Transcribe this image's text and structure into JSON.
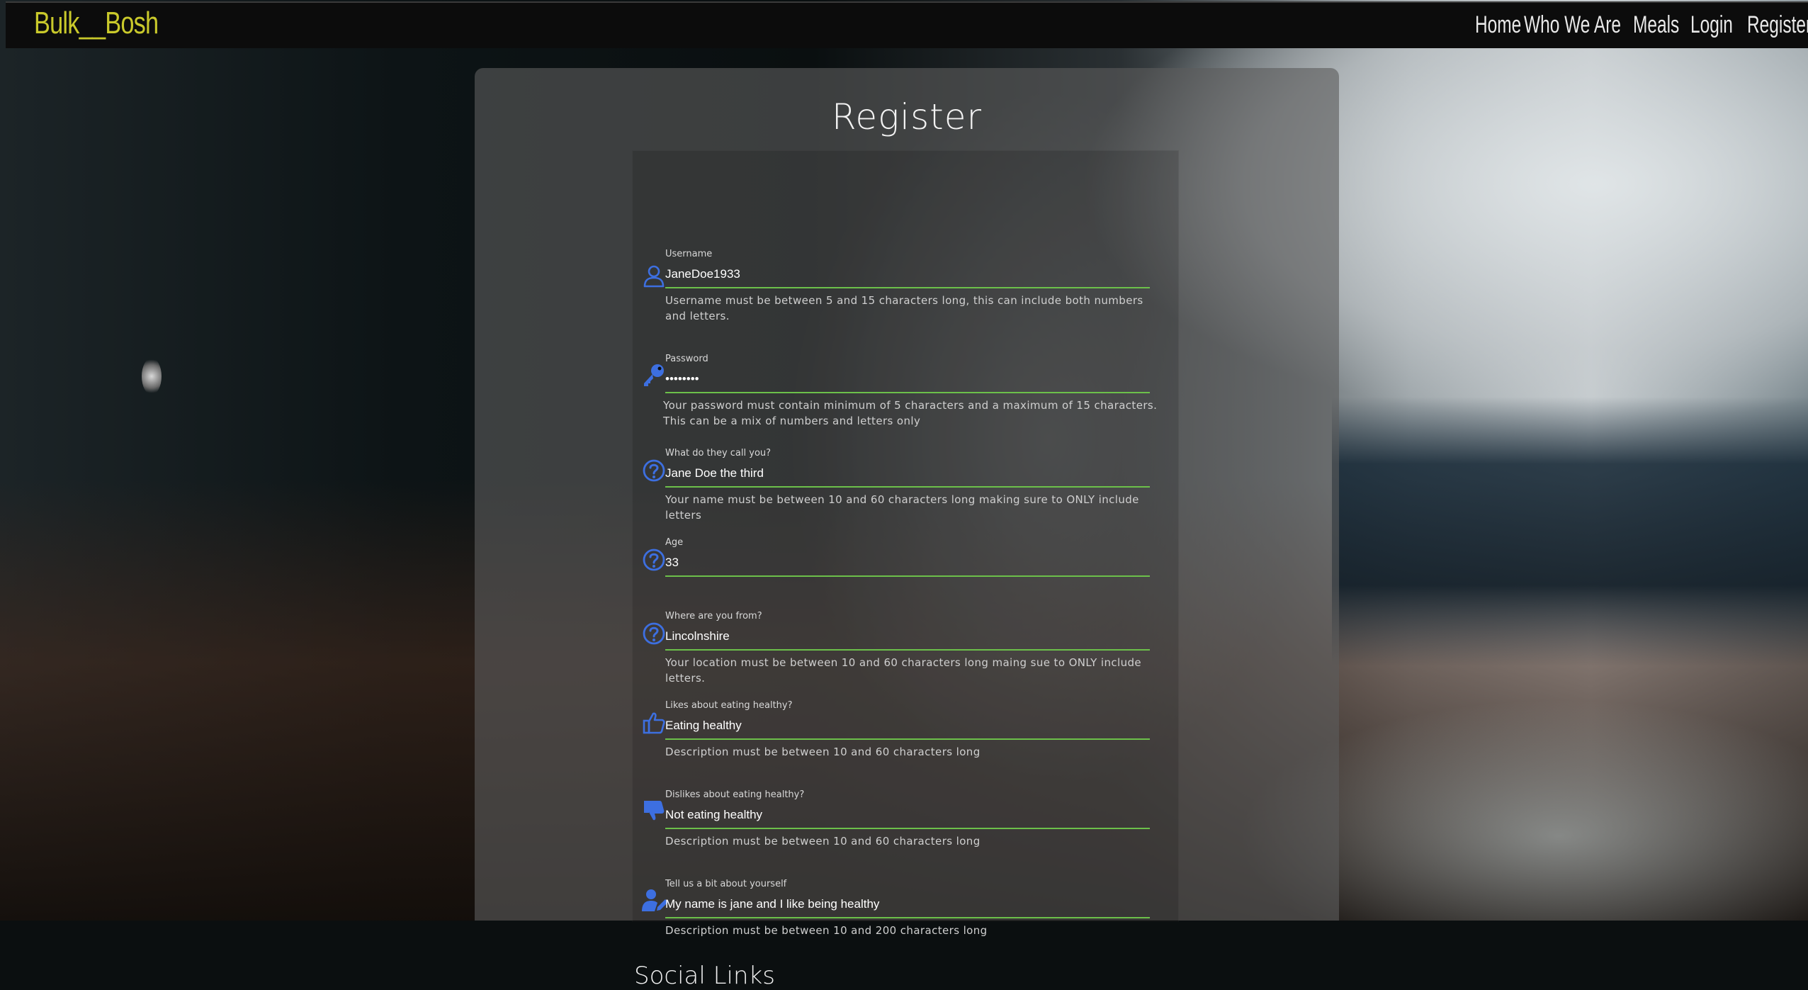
{
  "nav": {
    "brand": "Bulk__Bosh",
    "links": [
      "Home",
      "Who We Are",
      "Meals",
      "Login",
      "Register"
    ]
  },
  "form": {
    "title": "Register",
    "fields": [
      {
        "label": "Username",
        "value": "JaneDoe1933",
        "icon": "user-icon",
        "help": "Username must be between 5 and 15 characters long, this can include both numbers and letters."
      },
      {
        "label": "Password",
        "value": "••••••••",
        "icon": "key-icon",
        "help": "Your password must contain minimum of 5 characters and a maximum of 15 characters. This can be a mix of numbers and letters only"
      },
      {
        "label": "What do they call you?",
        "value": "Jane Doe the third",
        "icon": "question-circle-icon",
        "help": "Your name must be between 10 and 60 characters long making sure to ONLY include letters"
      },
      {
        "label": "Age",
        "value": "33",
        "icon": "question-circle-icon",
        "help": ""
      },
      {
        "label": "Where are you from?",
        "value": "Lincolnshire",
        "icon": "question-circle-icon",
        "help": "Your location must be between 10 and 60 characters long maing sue to ONLY include letters."
      },
      {
        "label": "Likes about eating healthy?",
        "value": "Eating healthy",
        "icon": "thumbs-up-icon",
        "help": "Description must be between 10 and 60 characters long"
      },
      {
        "label": "Dislikes about eating healthy?",
        "value": "Not eating healthy",
        "icon": "thumbs-down-icon",
        "help": "Description must be between 10 and 60 characters long"
      },
      {
        "label": "Tell us a bit about yourself",
        "value": "My name is jane and I like being healthy",
        "icon": "user-edit-icon",
        "help": "Description must be between 10 and 200 characters long"
      }
    ],
    "social_heading": "Social Links"
  },
  "colors": {
    "brand": "#c9c92b",
    "icon": "#3d6fe0",
    "input_underline": "#6cc04a"
  }
}
